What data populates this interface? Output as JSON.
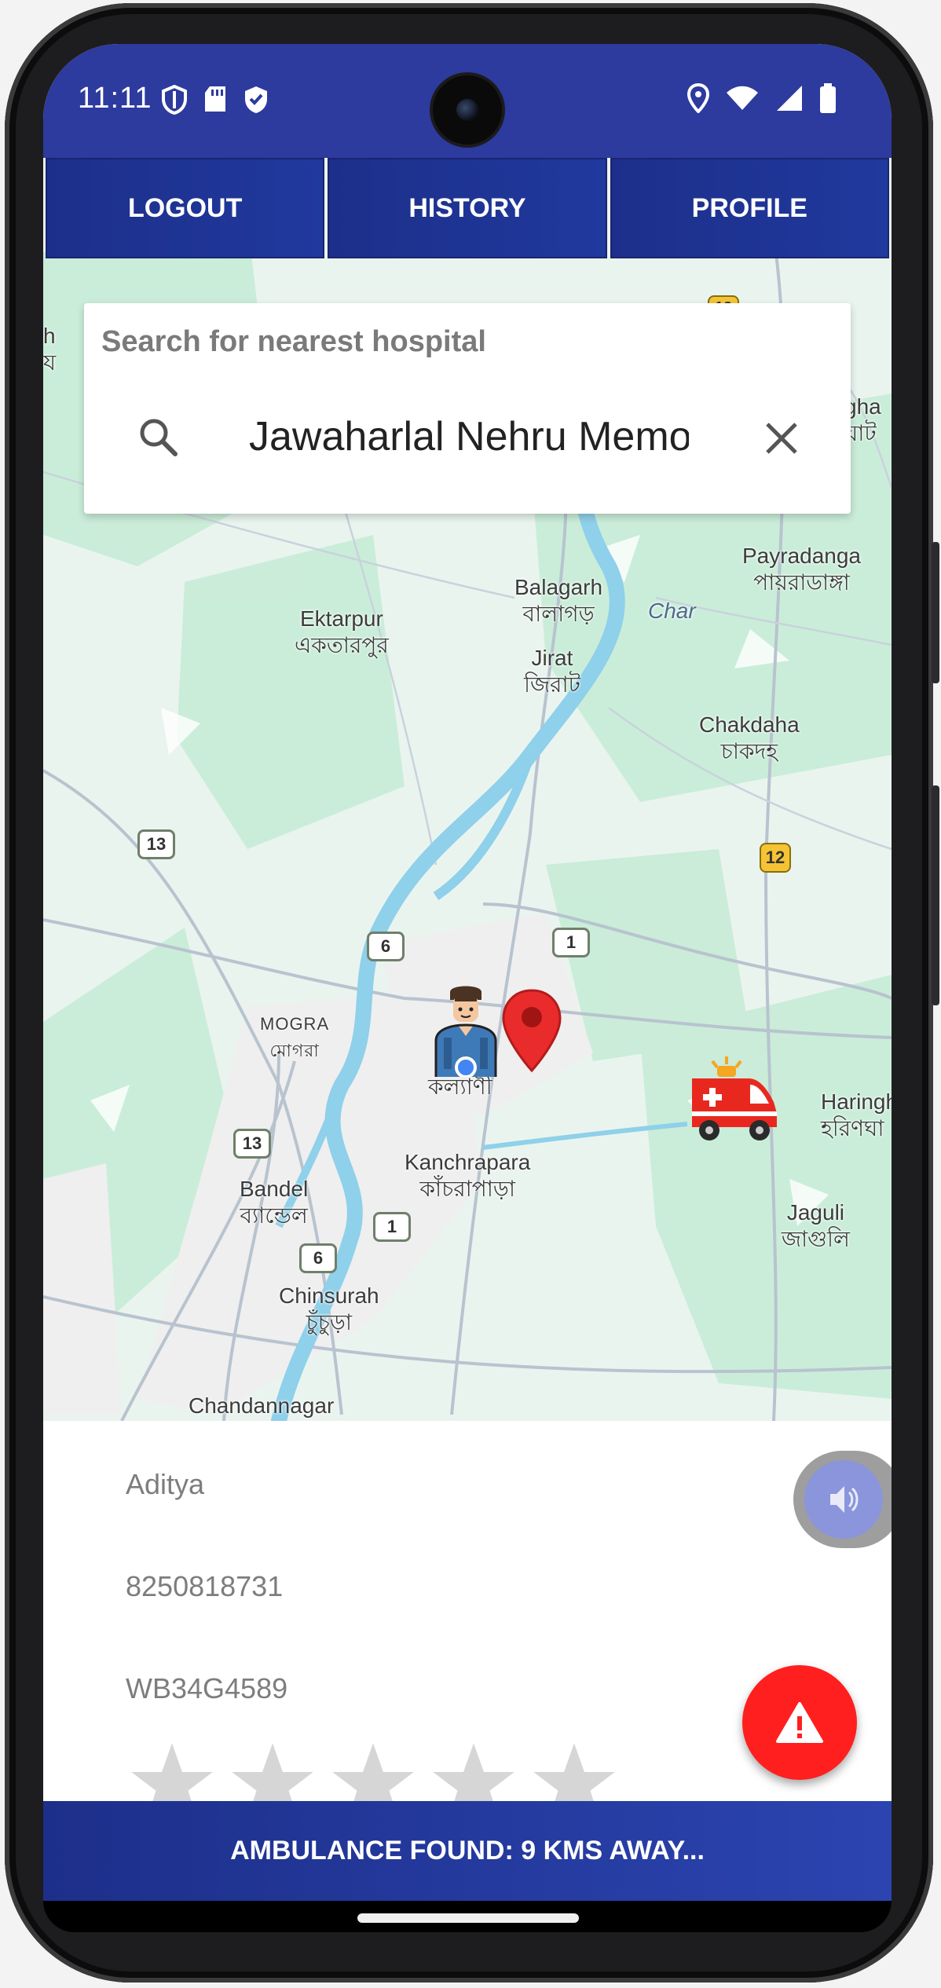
{
  "status_bar": {
    "time": "11:11",
    "left_icons": [
      "shield-icon",
      "sd-card-icon",
      "shield-check-icon"
    ],
    "right_icons": [
      "location-icon",
      "wifi-icon",
      "signal-icon",
      "battery-icon"
    ]
  },
  "nav": {
    "logout": "LOGOUT",
    "history": "HISTORY",
    "profile": "PROFILE",
    "color": "#1d2f8a"
  },
  "search": {
    "title": "Search for nearest hospital",
    "value": "Jawaharlal Nehru Memo"
  },
  "map": {
    "labels": {
      "ektarpur_en": "Ektarpur",
      "ektarpur_bn": "একতারপুর",
      "balagarh_en": "Balagarh",
      "balagarh_bn": "বালাগড়",
      "char": "Char",
      "jirat_en": "Jirat",
      "jirat_bn": "জিরাট",
      "payradanga_en": "Payradanga",
      "payradanga_bn": "পায়রাডাঙ্গা",
      "chakdaha_en": "Chakdaha",
      "chakdaha_bn": "চাকদহ",
      "mogra_en": "MOGRA",
      "mogra_bn": "মোগরা",
      "kalyani_bn": "কল্যাণী",
      "haringhata_en": "Haringh",
      "haringhata_bn": "হরিণঘা",
      "kanchrapara_en": "Kanchrapara",
      "kanchrapara_bn": "কাঁচরাপাড়া",
      "bandel_en": "Bandel",
      "bandel_bn": "ব্যান্ডেল",
      "jaguli_en": "Jaguli",
      "jaguli_bn": "জাগুলি",
      "chinsurah_en": "Chinsurah",
      "chinsurah_bn": "চুঁচুড়া",
      "chandannagar_en": "Chandannagar",
      "right_top_1": "gha",
      "right_top_2": "ঘাট",
      "left_top_1": "h",
      "left_top_2": "য"
    },
    "route_shields": [
      "13",
      "6",
      "1",
      "12",
      "13",
      "6",
      "1",
      "12"
    ],
    "markers": [
      "user-marker-icon",
      "destination-pin-icon",
      "ambulance-icon"
    ],
    "water_color": "#8fd0ea",
    "green_color": "#c7ecd6"
  },
  "driver": {
    "name": "Aditya",
    "phone": "8250818731",
    "vehicle": "WB34G4589",
    "rating": 0,
    "rating_max": 5
  },
  "footer": {
    "status": "AMBULANCE FOUND: 9 KMS AWAY..."
  },
  "colors": {
    "accent": "#2d3a9e",
    "sos": "#ff1f1f"
  }
}
